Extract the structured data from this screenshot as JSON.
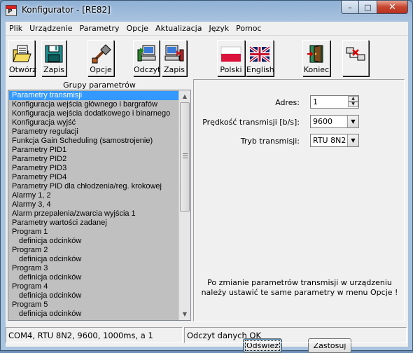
{
  "window": {
    "title": "Konfigurator - [RE82]",
    "app_icon_text": "P",
    "caption": {
      "minimize": "–",
      "maximize": "□",
      "close": "✕"
    }
  },
  "menu": [
    "Plik",
    "Urządzenie",
    "Parametry",
    "Opcje",
    "Aktualizacja",
    "Język",
    "Pomoc"
  ],
  "toolbar": {
    "open": "Otwórz",
    "save": "Zapis",
    "options": "Opcje",
    "read": "Odczyt",
    "write": "Zapis",
    "polish": "Polski",
    "english": "English",
    "exit": "Koniec"
  },
  "params_panel": {
    "title": "Grupy parametrów",
    "selected_index": 0,
    "items": [
      {
        "label": "Parametry transmisji",
        "indent": false
      },
      {
        "label": "Konfiguracja wejścia głównego i bargrafów",
        "indent": false
      },
      {
        "label": "Konfiguracja wejścia dodatkowego i binarnego",
        "indent": false
      },
      {
        "label": "Konfiguracja wyjść",
        "indent": false
      },
      {
        "label": "Parametry regulacji",
        "indent": false
      },
      {
        "label": "Funkcja Gain Scheduling (samostrojenie)",
        "indent": false
      },
      {
        "label": "Parametry PID1",
        "indent": false
      },
      {
        "label": "Parametry PID2",
        "indent": false
      },
      {
        "label": "Parametry PID3",
        "indent": false
      },
      {
        "label": "Parametry PID4",
        "indent": false
      },
      {
        "label": "Parametry PID dla chłodzenia/reg. krokowej",
        "indent": false
      },
      {
        "label": "Alarmy 1, 2",
        "indent": false
      },
      {
        "label": "Alarmy 3, 4",
        "indent": false
      },
      {
        "label": "Alarm przepalenia/zwarcia wyjścia 1",
        "indent": false
      },
      {
        "label": "Parametry wartości zadanej",
        "indent": false
      },
      {
        "label": "Program 1",
        "indent": false
      },
      {
        "label": "definicja odcinków",
        "indent": true
      },
      {
        "label": "Program 2",
        "indent": false
      },
      {
        "label": "definicja odcinków",
        "indent": true
      },
      {
        "label": "Program 3",
        "indent": false
      },
      {
        "label": "definicja odcinków",
        "indent": true
      },
      {
        "label": "Program 4",
        "indent": false
      },
      {
        "label": "definicja odcinków",
        "indent": true
      },
      {
        "label": "Program 5",
        "indent": false
      },
      {
        "label": "definicja odcinków",
        "indent": true
      }
    ]
  },
  "form": {
    "address_label": "Adres:",
    "address_value": "1",
    "baud_label": "Prędkość transmisji [b/s]:",
    "baud_value": "9600",
    "mode_label": "Tryb transmisji:",
    "mode_value": "RTU 8N2",
    "info_line1": "Po zmianie parametrów transmisji w urządzeniu",
    "info_line2": "należy ustawić te same parametry w menu Opcje !",
    "refresh_button": "Odśwież",
    "apply_button": "Zastosuj"
  },
  "status": {
    "connection": "COM4, RTU 8N2, 9600, 1000ms, a 1",
    "message": "Odczyt danych OK"
  },
  "colors": {
    "selection": "#3399ff",
    "list_background": "#c0c0c0",
    "panel_background": "#f0f0f0",
    "close_button": "#c7452f"
  }
}
